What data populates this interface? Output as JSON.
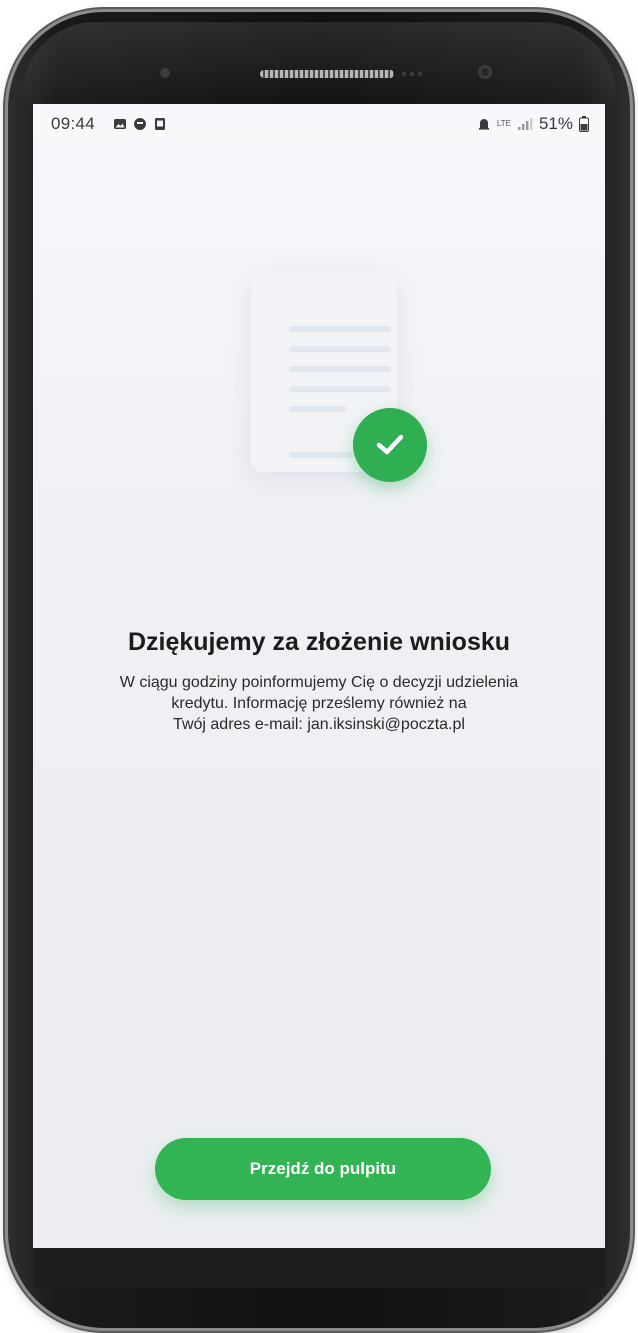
{
  "status_bar": {
    "time": "09:44",
    "battery": "51%",
    "network": "LTE"
  },
  "illustration": {
    "icon": "document-check-icon"
  },
  "content": {
    "title": "Dziękujemy za złożenie wniosku",
    "message_lines": [
      "W ciągu godziny poinformujemy Cię o decyzji udzielenia",
      "kredytu. Informację prześlemy również na",
      "Twój adres e-mail: jan.iksinski@poczta.pl"
    ]
  },
  "actions": {
    "primary_label": "Przejdź do pulpitu"
  },
  "colors": {
    "accent": "#33b454",
    "text": "#1c1c1c"
  }
}
